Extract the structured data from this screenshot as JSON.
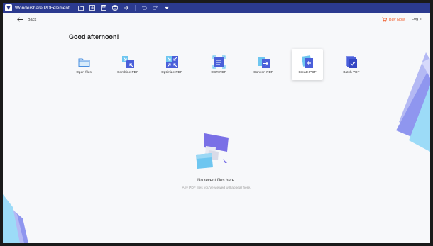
{
  "app": {
    "title": "Wondershare PDFelement"
  },
  "topbar": {
    "back_label": "Back",
    "buy_label": "Buy Now",
    "login_label": "Log In"
  },
  "greeting": "Good afternoon!",
  "tools": [
    {
      "label": "Open files",
      "icon": "open-folder-icon"
    },
    {
      "label": "Combine PDF",
      "icon": "combine-pdf-icon"
    },
    {
      "label": "Optimize PDF",
      "icon": "optimize-pdf-icon"
    },
    {
      "label": "OCR PDF",
      "icon": "ocr-pdf-icon"
    },
    {
      "label": "Convert PDF",
      "icon": "convert-pdf-icon"
    },
    {
      "label": "Create PDF",
      "icon": "create-pdf-icon"
    },
    {
      "label": "Batch PDF",
      "icon": "batch-pdf-icon"
    }
  ],
  "recent": {
    "empty_title": "No recent files here.",
    "empty_subtitle": "Any PDF files you've viewed will appear here."
  },
  "colors": {
    "titlebar": "#2b3a8f",
    "accent": "#4a5fd9",
    "accent_light": "#6ec6f0",
    "buy_now": "#f05a28"
  }
}
